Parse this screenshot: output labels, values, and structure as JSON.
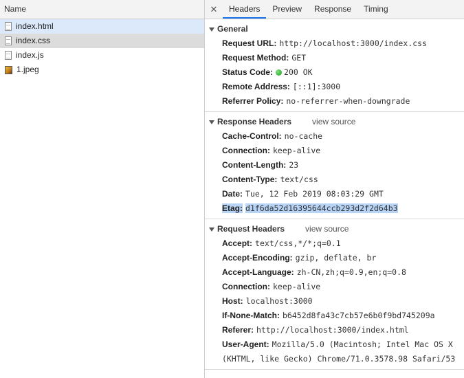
{
  "files": {
    "header": "Name",
    "items": [
      {
        "name": "index.html",
        "type": "document"
      },
      {
        "name": "index.css",
        "type": "document"
      },
      {
        "name": "index.js",
        "type": "document"
      },
      {
        "name": "1.jpeg",
        "type": "image"
      }
    ]
  },
  "tabs": {
    "close": "✕",
    "items": [
      "Headers",
      "Preview",
      "Response",
      "Timing"
    ]
  },
  "general": {
    "title": "General",
    "request_url_k": "Request URL:",
    "request_url_v": "http://localhost:3000/index.css",
    "method_k": "Request Method:",
    "method_v": "GET",
    "status_k": "Status Code:",
    "status_v": "200 OK",
    "remote_k": "Remote Address:",
    "remote_v": "[::1]:3000",
    "referrer_k": "Referrer Policy:",
    "referrer_v": "no-referrer-when-downgrade"
  },
  "response_headers": {
    "title": "Response Headers",
    "view_source": "view source",
    "rows": [
      {
        "k": "Cache-Control:",
        "v": "no-cache"
      },
      {
        "k": "Connection:",
        "v": "keep-alive"
      },
      {
        "k": "Content-Length:",
        "v": "23"
      },
      {
        "k": "Content-Type:",
        "v": "text/css"
      },
      {
        "k": "Date:",
        "v": "Tue, 12 Feb 2019 08:03:29 GMT"
      },
      {
        "k": "Etag:",
        "v": "d1f6da52d16395644ccb293d2f2d64b3"
      }
    ]
  },
  "request_headers": {
    "title": "Request Headers",
    "view_source": "view source",
    "rows": [
      {
        "k": "Accept:",
        "v": "text/css,*/*;q=0.1"
      },
      {
        "k": "Accept-Encoding:",
        "v": "gzip, deflate, br"
      },
      {
        "k": "Accept-Language:",
        "v": "zh-CN,zh;q=0.9,en;q=0.8"
      },
      {
        "k": "Connection:",
        "v": "keep-alive"
      },
      {
        "k": "Host:",
        "v": "localhost:3000"
      },
      {
        "k": "If-None-Match:",
        "v": "b6452d8fa43c7cb57e6b0f9bd745209a"
      },
      {
        "k": "Referer:",
        "v": "http://localhost:3000/index.html"
      },
      {
        "k": "User-Agent:",
        "v": "Mozilla/5.0 (Macintosh; Intel Mac OS X"
      }
    ],
    "user_agent_cont": "(KHTML, like Gecko) Chrome/71.0.3578.98 Safari/53"
  },
  "colors": {
    "accent": "#1a73e8",
    "selection": "#dbe9fb",
    "highlight": "#b7d4f7",
    "status_ok": "#1a9c1a"
  }
}
